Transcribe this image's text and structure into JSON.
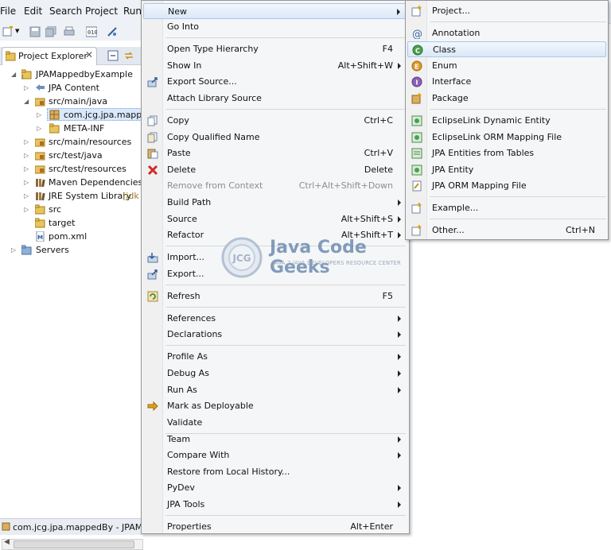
{
  "menubar": {
    "items": [
      "File",
      "Edit",
      "Search",
      "Project",
      "Run"
    ]
  },
  "explorer": {
    "tab_title": "Project Explorer",
    "tree": [
      {
        "label": "JPAMappedbyExample",
        "extra": ""
      },
      {
        "label": "JPA Content",
        "extra": ""
      },
      {
        "label": "src/main/java",
        "extra": ""
      },
      {
        "label": "com.jcg.jpa.mappe",
        "extra": ""
      },
      {
        "label": "META-INF",
        "extra": ""
      },
      {
        "label": "src/main/resources",
        "extra": ""
      },
      {
        "label": "src/test/java",
        "extra": ""
      },
      {
        "label": "src/test/resources",
        "extra": ""
      },
      {
        "label": "Maven Dependencies",
        "extra": ""
      },
      {
        "label": "JRE System Library",
        "extra": "[jdk"
      },
      {
        "label": "src",
        "extra": ""
      },
      {
        "label": "target",
        "extra": ""
      },
      {
        "label": "pom.xml",
        "extra": ""
      },
      {
        "label": "Servers",
        "extra": ""
      }
    ],
    "status_text": "com.jcg.jpa.mappedBy - JPAMap"
  },
  "context_menu": {
    "items": [
      {
        "label": "New",
        "accel": ""
      },
      {
        "label": "Go Into",
        "accel": ""
      },
      {
        "label": "Open Type Hierarchy",
        "accel": "F4"
      },
      {
        "label": "Show In",
        "accel": "Alt+Shift+W"
      },
      {
        "label": "Export Source...",
        "accel": ""
      },
      {
        "label": "Attach Library Source",
        "accel": ""
      },
      {
        "label": "Copy",
        "accel": "Ctrl+C"
      },
      {
        "label": "Copy Qualified Name",
        "accel": ""
      },
      {
        "label": "Paste",
        "accel": "Ctrl+V"
      },
      {
        "label": "Delete",
        "accel": "Delete"
      },
      {
        "label": "Remove from Context",
        "accel": "Ctrl+Alt+Shift+Down"
      },
      {
        "label": "Build Path",
        "accel": ""
      },
      {
        "label": "Source",
        "accel": "Alt+Shift+S"
      },
      {
        "label": "Refactor",
        "accel": "Alt+Shift+T"
      },
      {
        "label": "Import...",
        "accel": ""
      },
      {
        "label": "Export...",
        "accel": ""
      },
      {
        "label": "Refresh",
        "accel": "F5"
      },
      {
        "label": "References",
        "accel": ""
      },
      {
        "label": "Declarations",
        "accel": ""
      },
      {
        "label": "Profile As",
        "accel": ""
      },
      {
        "label": "Debug As",
        "accel": ""
      },
      {
        "label": "Run As",
        "accel": ""
      },
      {
        "label": "Mark as Deployable",
        "accel": ""
      },
      {
        "label": "Validate",
        "accel": ""
      },
      {
        "label": "Team",
        "accel": ""
      },
      {
        "label": "Compare With",
        "accel": ""
      },
      {
        "label": "Restore from Local History...",
        "accel": ""
      },
      {
        "label": "PyDev",
        "accel": ""
      },
      {
        "label": "JPA Tools",
        "accel": ""
      },
      {
        "label": "Properties",
        "accel": "Alt+Enter"
      }
    ]
  },
  "new_submenu": {
    "items": [
      {
        "label": "Project...",
        "accel": ""
      },
      {
        "label": "Annotation",
        "accel": ""
      },
      {
        "label": "Class",
        "accel": ""
      },
      {
        "label": "Enum",
        "accel": ""
      },
      {
        "label": "Interface",
        "accel": ""
      },
      {
        "label": "Package",
        "accel": ""
      },
      {
        "label": "EclipseLink Dynamic Entity",
        "accel": ""
      },
      {
        "label": "EclipseLink ORM Mapping File",
        "accel": ""
      },
      {
        "label": "JPA Entities from Tables",
        "accel": ""
      },
      {
        "label": "JPA Entity",
        "accel": ""
      },
      {
        "label": "JPA ORM Mapping File",
        "accel": ""
      },
      {
        "label": "Example...",
        "accel": ""
      },
      {
        "label": "Other...",
        "accel": "Ctrl+N"
      }
    ]
  },
  "watermark": {
    "logo_text": "JCG",
    "title": "Java Code Geeks",
    "subtitle": "JAVA 2 JAVA DEVELOPERS RESOURCE CENTER"
  },
  "colors": {
    "highlight": "#dbe8f8",
    "highlight_border": "#a8c8ec",
    "menu_bg": "#f5f6f7",
    "watermark": "#5b7fa8"
  }
}
